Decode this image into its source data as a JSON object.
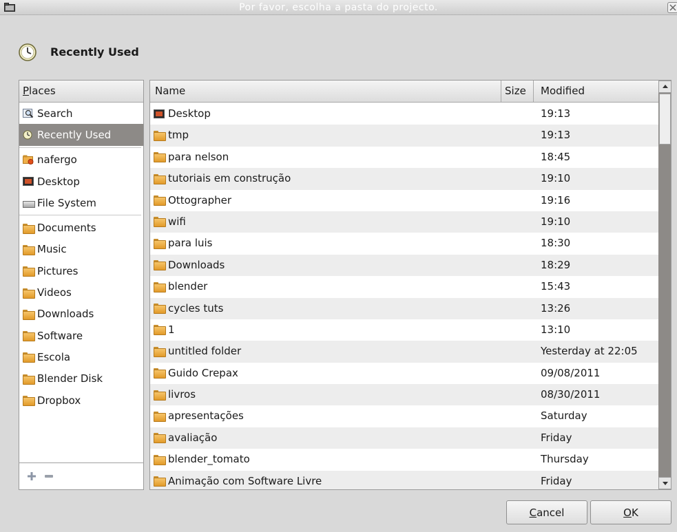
{
  "window": {
    "title": "Por favor, escolha a pasta do projecto."
  },
  "header": {
    "title": "Recently Used"
  },
  "places": {
    "header": "Places",
    "header_mnemonic": "P",
    "header_rest": "laces",
    "items": [
      {
        "label": "Search",
        "icon": "search-icon"
      },
      {
        "label": "Recently Used",
        "icon": "clock-icon",
        "selected": true
      },
      {
        "label": "nafergo",
        "icon": "home-folder-icon"
      },
      {
        "label": "Desktop",
        "icon": "desktop-icon"
      },
      {
        "label": "File System",
        "icon": "drive-icon"
      },
      {
        "label": "Documents",
        "icon": "folder-icon"
      },
      {
        "label": "Music",
        "icon": "folder-icon"
      },
      {
        "label": "Pictures",
        "icon": "folder-icon"
      },
      {
        "label": "Videos",
        "icon": "folder-icon"
      },
      {
        "label": "Downloads",
        "icon": "folder-icon"
      },
      {
        "label": "Software",
        "icon": "folder-icon"
      },
      {
        "label": "Escola",
        "icon": "folder-icon"
      },
      {
        "label": "Blender Disk",
        "icon": "folder-icon"
      },
      {
        "label": "Dropbox",
        "icon": "folder-icon"
      }
    ]
  },
  "files": {
    "columns": {
      "name": "Name",
      "size": "Size",
      "modified": "Modified"
    },
    "rows": [
      {
        "name": "Desktop",
        "modified": "19:13",
        "icon": "desktop-icon"
      },
      {
        "name": "tmp",
        "modified": "19:13",
        "icon": "folder-icon"
      },
      {
        "name": "para nelson",
        "modified": "18:45",
        "icon": "folder-icon"
      },
      {
        "name": "tutoriais em construção",
        "modified": "19:10",
        "icon": "folder-icon"
      },
      {
        "name": "Ottographer",
        "modified": "19:16",
        "icon": "folder-icon"
      },
      {
        "name": "wifi",
        "modified": "19:10",
        "icon": "folder-icon"
      },
      {
        "name": "para luis",
        "modified": "18:30",
        "icon": "folder-icon"
      },
      {
        "name": "Downloads",
        "modified": "18:29",
        "icon": "folder-icon"
      },
      {
        "name": "blender",
        "modified": "15:43",
        "icon": "folder-icon"
      },
      {
        "name": "cycles tuts",
        "modified": "13:26",
        "icon": "folder-icon"
      },
      {
        "name": "1",
        "modified": "13:10",
        "icon": "folder-icon"
      },
      {
        "name": "untitled folder",
        "modified": "Yesterday at 22:05",
        "icon": "folder-icon"
      },
      {
        "name": "Guido Crepax",
        "modified": "09/08/2011",
        "icon": "folder-icon"
      },
      {
        "name": "livros",
        "modified": "08/30/2011",
        "icon": "folder-icon"
      },
      {
        "name": "apresentações",
        "modified": "Saturday",
        "icon": "folder-icon"
      },
      {
        "name": "avaliação",
        "modified": "Friday",
        "icon": "folder-icon"
      },
      {
        "name": "blender_tomato",
        "modified": "Thursday",
        "icon": "folder-icon"
      },
      {
        "name": "Animação com Software Livre",
        "modified": "Friday",
        "icon": "folder-icon"
      }
    ]
  },
  "buttons": {
    "cancel": {
      "label": "Cancel",
      "mnemonic": "C",
      "rest": "ancel"
    },
    "ok": {
      "label": "OK",
      "mnemonic": "O",
      "rest": "K"
    }
  }
}
